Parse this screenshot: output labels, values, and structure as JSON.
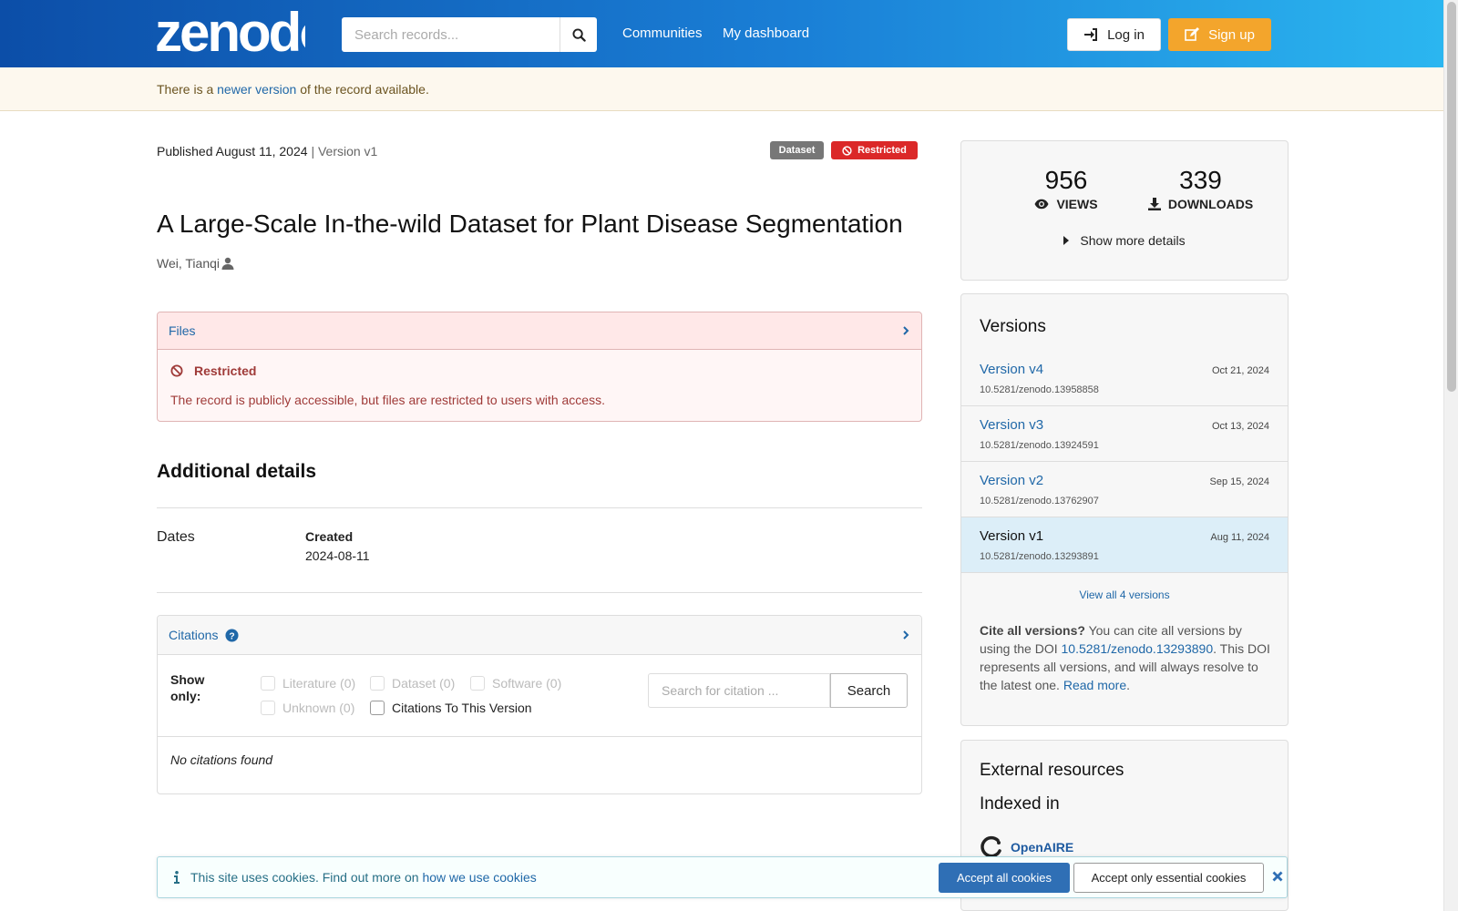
{
  "header": {
    "logo_text": "zenodo",
    "search_placeholder": "Search records...",
    "nav": [
      "Communities",
      "My dashboard"
    ],
    "login_label": "Log in",
    "signup_label": "Sign up",
    "colors": {
      "gradient_start": "#0c4ea8",
      "gradient_end": "#2bb6f0",
      "signup": "#f3a52c"
    }
  },
  "banner": {
    "prefix": "There is a",
    "link": "newer version",
    "suffix": "of the record available."
  },
  "record": {
    "published": "Published August 11, 2024",
    "version": "| Version v1",
    "badge_type": "Dataset",
    "badge_access": "Restricted",
    "title": "A Large-Scale In-the-wild Dataset for Plant Disease Segmentation",
    "author": "Wei, Tianqi"
  },
  "files": {
    "label": "Files",
    "restricted_title": "Restricted",
    "restricted_msg": "The record is publicly accessible, but files are restricted to users with access."
  },
  "details": {
    "title": "Additional details",
    "dates_label": "Dates",
    "created_label": "Created",
    "created_value": "2024-08-11"
  },
  "citations": {
    "label": "Citations",
    "show_only": "Show only:",
    "filters": [
      {
        "label": "Literature (0)",
        "enabled": false
      },
      {
        "label": "Dataset (0)",
        "enabled": false
      },
      {
        "label": "Software (0)",
        "enabled": false
      },
      {
        "label": "Unknown (0)",
        "enabled": false
      },
      {
        "label": "Citations To This Version",
        "enabled": true
      }
    ],
    "search_placeholder": "Search for citation ...",
    "search_button": "Search",
    "empty": "No citations found"
  },
  "stats": {
    "views": "956",
    "views_label": "VIEWS",
    "downloads": "339",
    "downloads_label": "DOWNLOADS",
    "more": "Show more details"
  },
  "versions": {
    "title": "Versions",
    "items": [
      {
        "name": "Version v4",
        "date": "Oct 21, 2024",
        "doi": "10.5281/zenodo.13958858",
        "active": false
      },
      {
        "name": "Version v3",
        "date": "Oct 13, 2024",
        "doi": "10.5281/zenodo.13924591",
        "active": false
      },
      {
        "name": "Version v2",
        "date": "Sep 15, 2024",
        "doi": "10.5281/zenodo.13762907",
        "active": false
      },
      {
        "name": "Version v1",
        "date": "Aug 11, 2024",
        "doi": "10.5281/zenodo.13293891",
        "active": true
      }
    ],
    "view_all": "View all 4 versions",
    "cite_bold": "Cite all versions?",
    "cite_text1": "You can cite all versions by using the DOI",
    "cite_doi": "10.5281/zenodo.13293890",
    "cite_text2": ". This DOI represents all versions, and will always resolve to the latest one.",
    "read_more": "Read more",
    "period": "."
  },
  "external": {
    "title": "External resources",
    "indexed": "Indexed in",
    "openaire": "OpenAIRE"
  },
  "cookies": {
    "text": "This site uses cookies. Find out more on",
    "link": "how we use cookies",
    "accept_all": "Accept all cookies",
    "accept_essential": "Accept only essential cookies"
  }
}
